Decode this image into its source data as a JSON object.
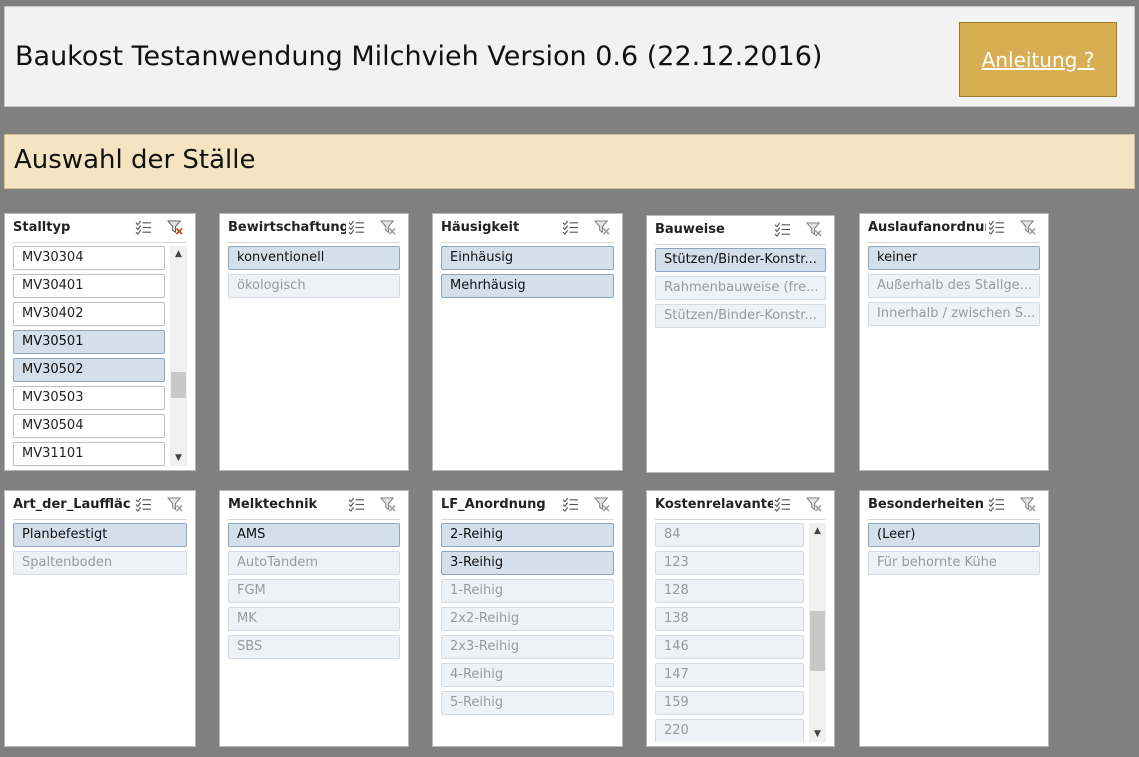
{
  "header": {
    "title": "Baukost Testanwendung Milchvieh Version 0.6 (22.12.2016)",
    "help_button": "Anleitung ?"
  },
  "section": {
    "title": "Auswahl der Ställe"
  },
  "colors": {
    "selected": "#d3e0ec",
    "unselected_dim": "#eef2f6",
    "accent": "#d8ae52",
    "section_bg": "#f4e4c2"
  },
  "slicers": {
    "stalltyp": {
      "title": "Stalltyp",
      "items": [
        "MV30304",
        "MV30401",
        "MV30402",
        "MV30501",
        "MV30502",
        "MV30503",
        "MV30504",
        "MV31101"
      ]
    },
    "bewirtschaftung": {
      "title": "Bewirtschaftung",
      "items": [
        "konventionell",
        "ökologisch"
      ]
    },
    "haeusigkeit": {
      "title": "Häusigkeit",
      "items": [
        "Einhäusig",
        "Mehrhäusig"
      ]
    },
    "bauweise": {
      "title": "Bauweise",
      "items": [
        "Stützen/Binder-Konstr...",
        "Rahmenbauweise (fre...",
        "Stützen/Binder-Konstr..."
      ]
    },
    "auslaufanordnung": {
      "title": "Auslaufanordnung",
      "items": [
        "keiner",
        "Außerhalb des Stallge...",
        "Innerhalb / zwischen S..."
      ]
    },
    "art_lauf": {
      "title": "Art_der_Lauffläc...",
      "items": [
        "Planbefestigt",
        "Spaltenboden"
      ]
    },
    "melktechnik": {
      "title": "Melktechnik",
      "items": [
        "AMS",
        "AutoTandem",
        "FGM",
        "MK",
        "SBS"
      ]
    },
    "lf_anordnung": {
      "title": "LF_Anordnung",
      "items": [
        "2-Reihig",
        "3-Reihig",
        "1-Reihig",
        "2x2-Reihig",
        "2x3-Reihig",
        "4-Reihig",
        "5-Reihig"
      ]
    },
    "kosten": {
      "title": "Kostenrelavante ...",
      "items": [
        "84",
        "123",
        "128",
        "138",
        "146",
        "147",
        "159",
        "220"
      ]
    },
    "besonderheiten": {
      "title": "Besonderheiten",
      "items": [
        "(Leer)",
        "Für behornte Kühe"
      ]
    }
  }
}
